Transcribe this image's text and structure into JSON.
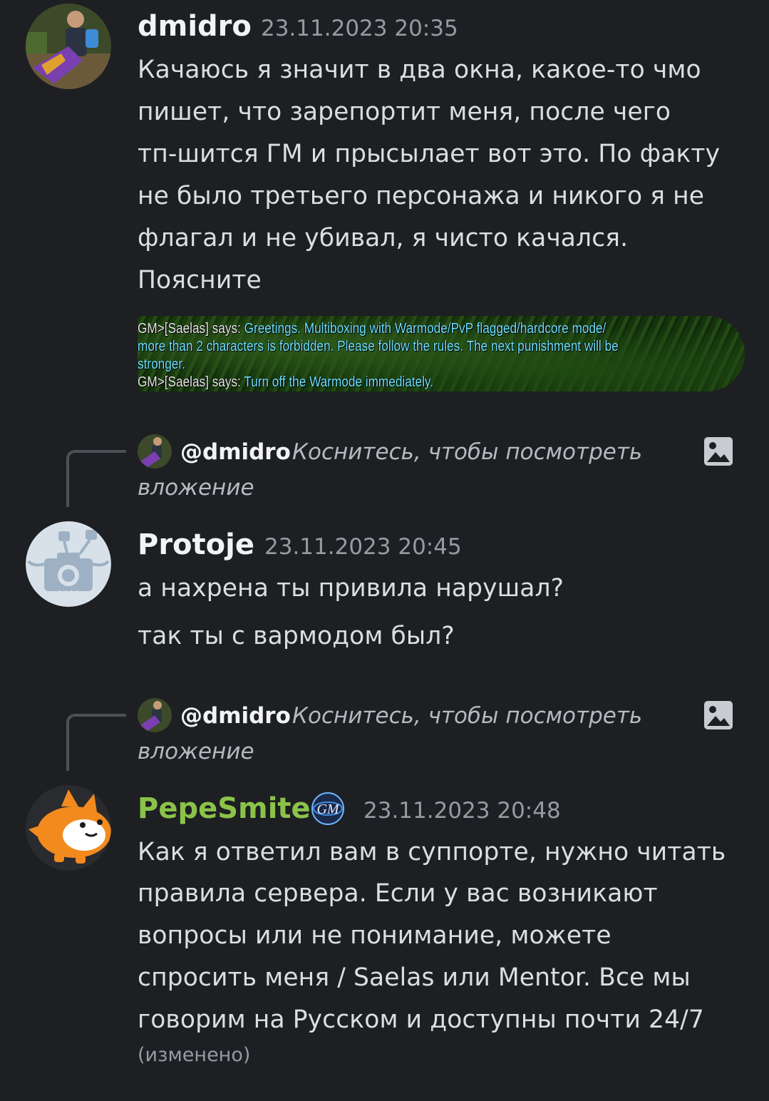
{
  "messages": {
    "dmidro": {
      "username": "dmidro",
      "timestamp": "23.11.2023 20:35",
      "lines": [
        "Качаюсь я значит в два окна, какое-то чмо",
        "пишет, что зарепортит меня, после чего",
        "тп-шится ГМ и прысылает вот это. По факту",
        "не было третьего персонажа и никого я не",
        "флагал и не убивал, я чисто качался.",
        "Поясните"
      ],
      "attachment": {
        "lines": [
          {
            "prefix": "GM>[Saelas] says: ",
            "text": "Greetings. Multiboxing with Warmode/PvP flagged/hardcore mode/"
          },
          {
            "prefix": "",
            "text": "more than 2 characters is forbidden. Please follow the rules. The next punishment will be"
          },
          {
            "prefix": "",
            "text": "stronger."
          },
          {
            "prefix": "GM>[Saelas] says: ",
            "text": "Turn off the Warmode immediately."
          }
        ]
      }
    },
    "protoje": {
      "reply": {
        "user": "@dmidro",
        "text_line1": "Коснитесь, чтобы посмотреть",
        "text_line2": "вложение"
      },
      "username": "Protoje",
      "timestamp": "23.11.2023 20:45",
      "lines": [
        "а нахрена ты привила нарушал?",
        "так ты с вармодом был?"
      ]
    },
    "pepesmite": {
      "reply": {
        "user": "@dmidro",
        "text_line1": "Коснитесь, чтобы посмотреть",
        "text_line2": "вложение"
      },
      "username": "PepeSmite",
      "username_color": "#8bc34a",
      "badge": "GM",
      "timestamp": "23.11.2023 20:48",
      "lines": [
        "Как я ответил вам в суппорте, нужно читать",
        "правила сервера. Если у вас возникают",
        "вопросы или не понимание, можете",
        "спросить меня / Saelas или Mentor. Все мы",
        "говорим на Русском и доступны почти 24/7"
      ],
      "edited": "(изменено)"
    }
  },
  "colors": {
    "background": "#1e1f22",
    "text": "#dbdee1",
    "muted": "#949ba4",
    "gm_text": "#6fe1ff"
  },
  "icons": [
    "image-attachment-icon",
    "gm-badge-icon",
    "avatar"
  ]
}
